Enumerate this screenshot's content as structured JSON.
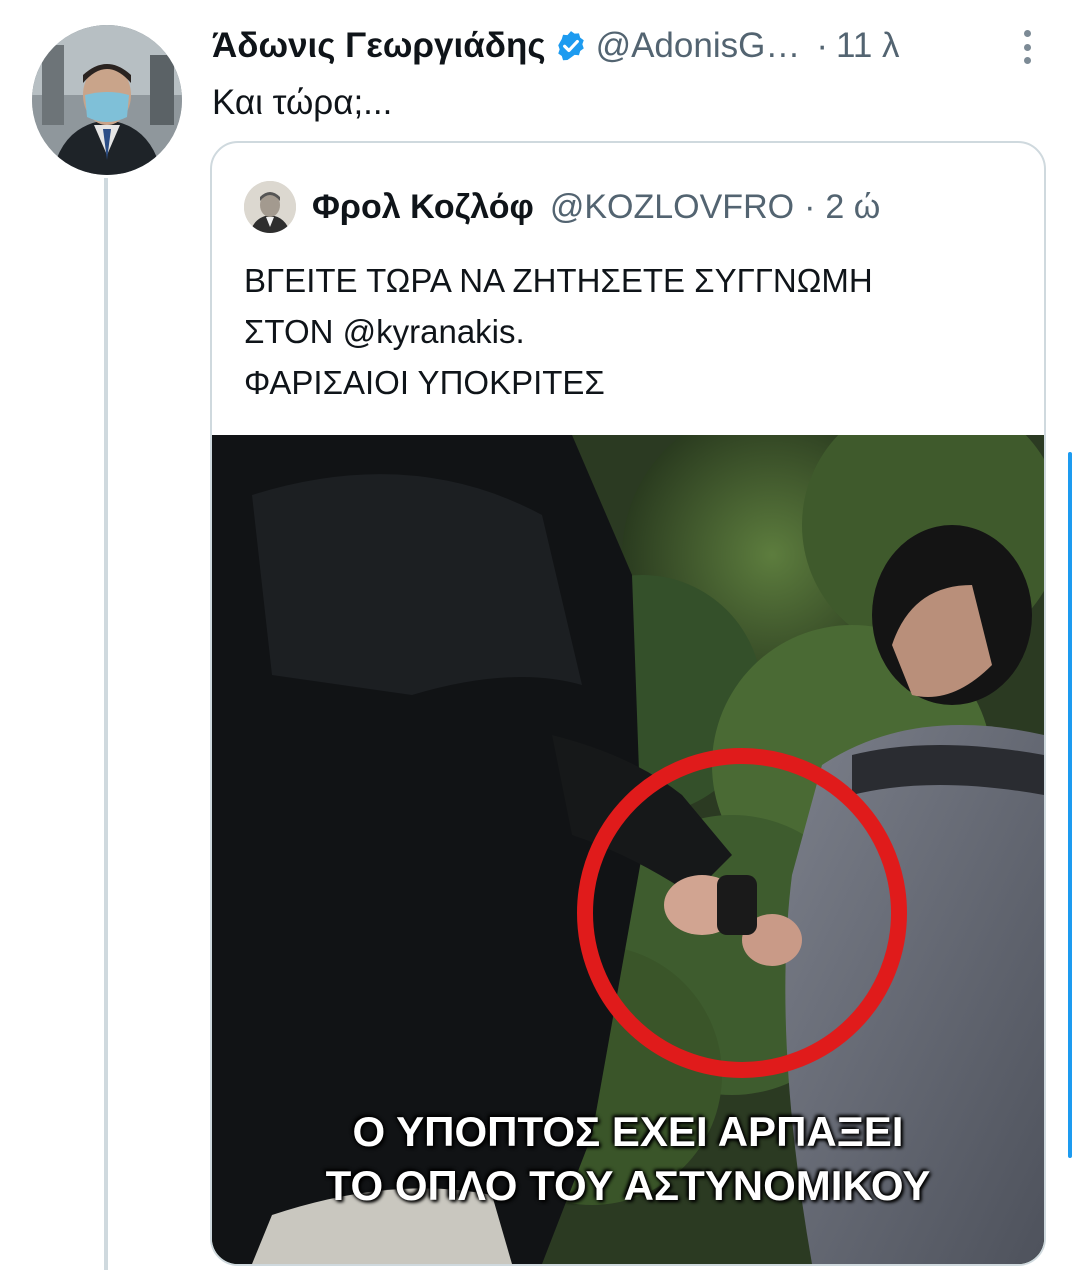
{
  "tweet": {
    "display_name": "Άδωνις Γεωργιάδης",
    "handle": "@AdonisG…",
    "separator": "·",
    "time": "11 λ",
    "text": "Και τώρα;..."
  },
  "quoted_tweet": {
    "display_name": "Φρολ Κοζλόφ",
    "handle": "@KOZLOVFRO",
    "separator": "·",
    "time": "2 ώ",
    "text_lines": [
      "ΒΓΕΙΤΕ ΤΩΡΑ ΝΑ ΖΗΤΗΣΕΤΕ ΣΥΓΓΝΩΜΗ",
      "ΣΤΟΝ @kyranakis.",
      "ΦΑΡΙΣΑΙΟΙ ΥΠΟΚΡΙΤΕΣ"
    ],
    "media_caption_lines": [
      "Ο ΥΠΟΠΤΟΣ ΕΧΕΙ ΑΡΠΑΞΕΙ",
      "ΤΟ ΟΠΛΟ ΤΟΥ ΑΣΤΥΝΟΜΙΚΟΥ"
    ]
  },
  "colors": {
    "accent": "#1d9bf0",
    "text_primary": "#0f1419",
    "text_secondary": "#536471",
    "border": "#cfd9de",
    "highlight_circle": "#e01b1b"
  },
  "icons": {
    "verified": "verified-badge-icon",
    "more": "more-vertical-icon"
  }
}
